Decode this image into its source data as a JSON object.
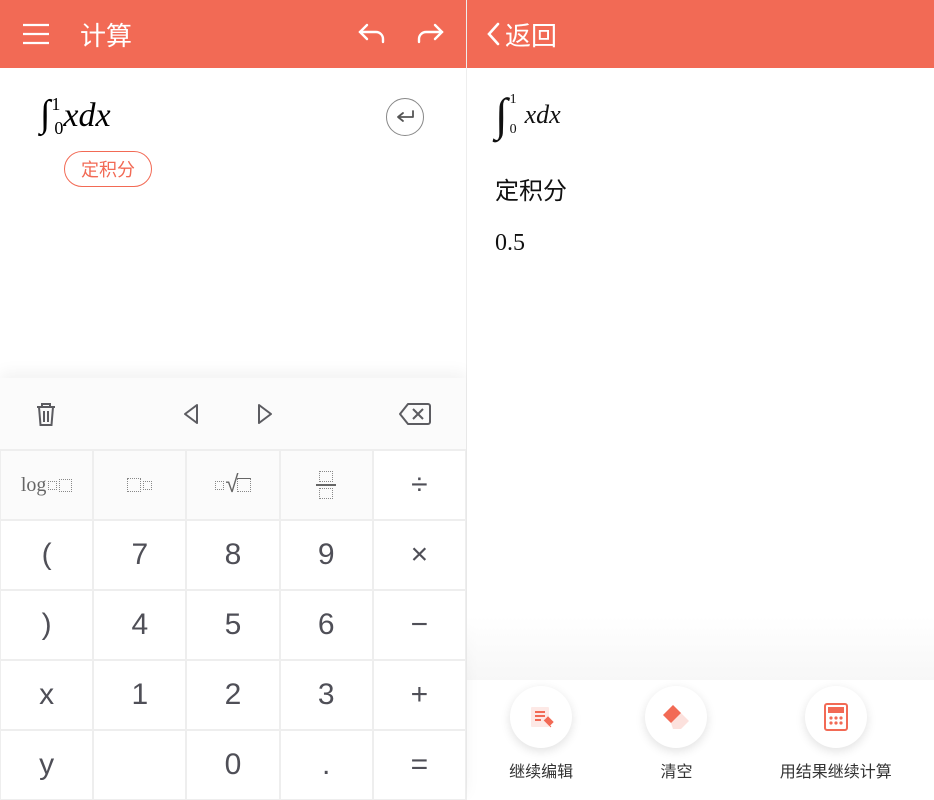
{
  "header": {
    "left_title": "计算",
    "back_label": "返回"
  },
  "input": {
    "expression_int": "∫",
    "expression_upper": "1",
    "expression_lower": "0",
    "expression_body": "xdx",
    "tag": "定积分"
  },
  "keypad": {
    "top": {
      "trash": "trash",
      "prev": "◁",
      "next": "▷",
      "backspace": "⌫"
    },
    "rows": [
      [
        "log□□",
        "□^□",
        "□√□",
        "□/□",
        "÷"
      ],
      [
        "(",
        "7",
        "8",
        "9",
        "×"
      ],
      [
        ")",
        "4",
        "5",
        "6",
        "−"
      ],
      [
        "x",
        "1",
        "2",
        "3",
        "+"
      ],
      [
        "y",
        "",
        "0",
        ".",
        "="
      ]
    ]
  },
  "result": {
    "int_upper": "1",
    "int_lower": "0",
    "body": "xdx",
    "label": "定积分",
    "value": "0.5"
  },
  "actions": {
    "a1": "继续编辑",
    "a2": "清空",
    "a3": "用结果继续计算"
  }
}
